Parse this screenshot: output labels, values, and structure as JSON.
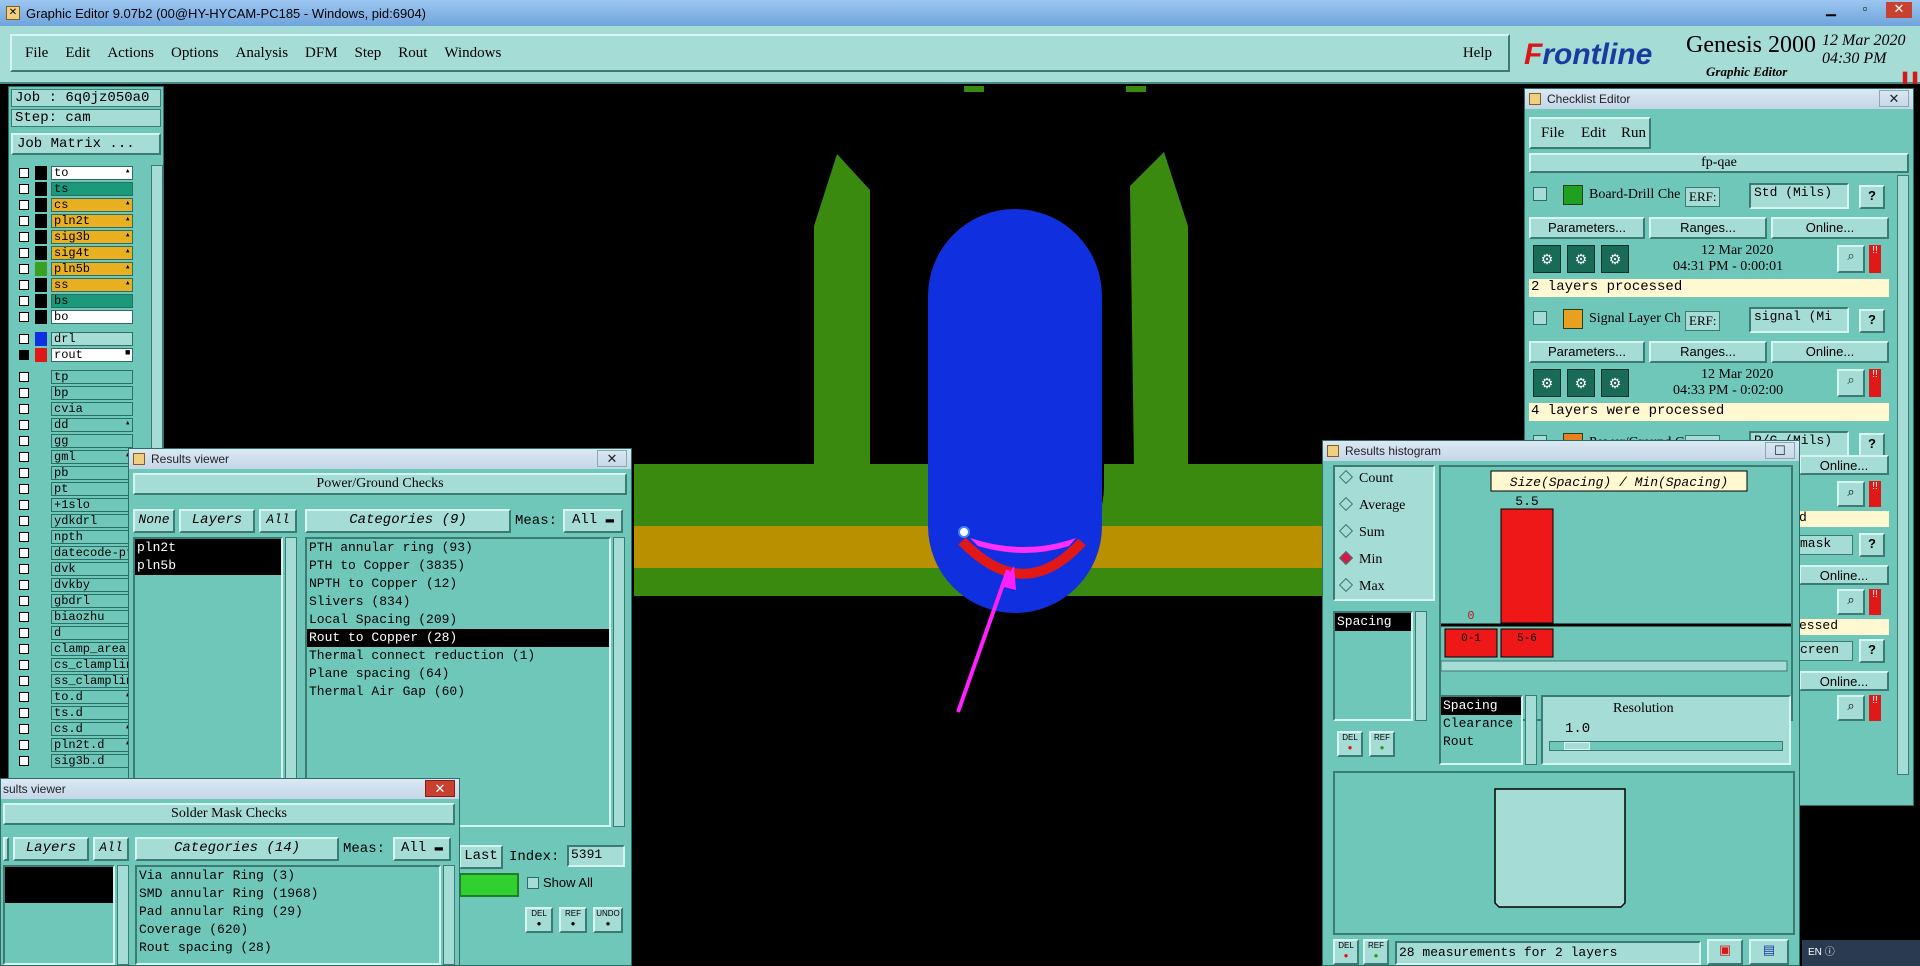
{
  "window": {
    "title": "Graphic Editor 9.07b2 (00@HY-HYCAM-PC185 - Windows, pid:6904)"
  },
  "menu": [
    "File",
    "Edit",
    "Actions",
    "Options",
    "Analysis",
    "DFM",
    "Step",
    "Rout",
    "Windows"
  ],
  "help": "Help",
  "brand": {
    "logo_red": "F",
    "logo_rest": "rontline",
    "product": "Genesis 2000",
    "subtitle": "Graphic Editor",
    "date": "12 Mar 2020",
    "time": "04:30 PM"
  },
  "job": {
    "job": "Job : 6q0jz050a0",
    "step": "Step: cam",
    "matrix_btn": "Job Matrix ..."
  },
  "layers_board": [
    {
      "name": "to",
      "color": "#ffffff",
      "sw": "#000000",
      "flag": "▴"
    },
    {
      "name": "ts",
      "color": "#1a9a7a",
      "sw": "#000000",
      "flag": ""
    },
    {
      "name": "cs",
      "color": "#e8b020",
      "sw": "#000000",
      "flag": "▴"
    },
    {
      "name": "pln2t",
      "color": "#e8b020",
      "sw": "#000000",
      "flag": "▴"
    },
    {
      "name": "sig3b",
      "color": "#e8b020",
      "sw": "#000000",
      "flag": "▴"
    },
    {
      "name": "sig4t",
      "color": "#e8b020",
      "sw": "#000000",
      "flag": "▴"
    },
    {
      "name": "pln5b",
      "color": "#e8b020",
      "sw": "#3aa020",
      "flag": "▴"
    },
    {
      "name": "ss",
      "color": "#e8b020",
      "sw": "#000000",
      "flag": "▴"
    },
    {
      "name": "bs",
      "color": "#1a9a7a",
      "sw": "#000000",
      "flag": ""
    },
    {
      "name": "bo",
      "color": "#ffffff",
      "sw": "#000000",
      "flag": ""
    }
  ],
  "layers_drill": [
    {
      "name": "drl",
      "color": "#a6dcd6",
      "sw": "#1030e0",
      "flag": ""
    },
    {
      "name": "rout",
      "color": "#ffffff",
      "sw": "#e01818",
      "flag": "■"
    }
  ],
  "layers_misc": [
    {
      "name": "tp",
      "flag": ""
    },
    {
      "name": "bp",
      "flag": ""
    },
    {
      "name": "cvia",
      "flag": ""
    },
    {
      "name": "dd",
      "flag": "▴"
    },
    {
      "name": "gg",
      "flag": ""
    },
    {
      "name": "gml",
      "flag": "▴"
    },
    {
      "name": "pb",
      "flag": ""
    },
    {
      "name": "pt",
      "flag": ""
    },
    {
      "name": "+1slo",
      "flag": ""
    },
    {
      "name": "ydkdrl",
      "flag": ""
    },
    {
      "name": "npth",
      "flag": ""
    },
    {
      "name": "datecode-pt",
      "flag": ""
    },
    {
      "name": "dvk",
      "flag": ""
    },
    {
      "name": "dvkby",
      "flag": ""
    },
    {
      "name": "gbdrl",
      "flag": ""
    },
    {
      "name": "biaozhu",
      "flag": ""
    },
    {
      "name": "d",
      "flag": ""
    },
    {
      "name": "clamp_area",
      "flag": ""
    },
    {
      "name": "cs_clamplin",
      "flag": ""
    },
    {
      "name": "ss_clamplin",
      "flag": ""
    },
    {
      "name": "to.d",
      "flag": "▴"
    },
    {
      "name": "ts.d",
      "flag": ""
    },
    {
      "name": "cs.d",
      "flag": "▴"
    },
    {
      "name": "pln2t.d",
      "flag": "▴"
    },
    {
      "name": "sig3b.d",
      "flag": ""
    }
  ],
  "results1": {
    "title": "Results viewer",
    "header": "Power/Ground Checks",
    "none": "None",
    "layers": "Layers",
    "all": "All",
    "categories": "Categories (9)",
    "meas_label": "Meas:",
    "meas_value": "All",
    "layer_items": [
      "pln2t",
      "pln5b"
    ],
    "cat_items": [
      "PTH annular ring (93)",
      "PTH to Copper (3835)",
      "NPTH to Copper (12)",
      "Slivers (834)",
      "Local Spacing (209)",
      "Rout to Copper (28)",
      "Thermal connect reduction (1)",
      "Plane spacing (64)",
      "Thermal Air Gap (60)"
    ],
    "selected_cat": 5,
    "last": "Last",
    "index_label": "Index:",
    "index_value": "5391",
    "show_all": "Show All",
    "del": "DEL",
    "ref": "REF",
    "undo": "UNDO"
  },
  "results2": {
    "title": "sults viewer",
    "header": "Solder Mask Checks",
    "layers": "Layers",
    "all": "All",
    "categories": "Categories (14)",
    "meas_label": "Meas:",
    "meas_value": "All",
    "cat_items": [
      "Via annular Ring (3)",
      "SMD annular Ring (1968)",
      "Pad annular Ring (29)",
      "Coverage (620)",
      "Rout spacing (28)"
    ]
  },
  "checklist": {
    "title": "Checklist Editor",
    "menu": [
      "File",
      "Edit",
      "Run"
    ],
    "name": "fp-qae",
    "erf": "ERF:",
    "params": "Parameters...",
    "ranges": "Ranges...",
    "online": "Online...",
    "checks": [
      {
        "name": "Board-Drill Che",
        "erf_val": "Std (Mils)",
        "date": "12 Mar 2020",
        "time": "04:31 PM - 0:00:01",
        "status": "2 layers processed"
      },
      {
        "name": "Signal Layer Ch",
        "erf_val": "signal (Mi",
        "date": "12 Mar 2020",
        "time": "04:33 PM - 0:02:00",
        "status": "4 layers were processed"
      },
      {
        "name": "Power/Ground C",
        "erf_val": "P/G (Mils)",
        "date": "",
        "time": "",
        "status": ""
      }
    ],
    "partial": [
      "d",
      "mask",
      "essed",
      "creen"
    ]
  },
  "histogram": {
    "title": "Results histogram",
    "radios": [
      "Count",
      "Average",
      "Sum",
      "Min",
      "Max"
    ],
    "selected_radio": 3,
    "left_item": "Spacing",
    "chart_title": "Size(Spacing) / Min(Spacing)",
    "bar_value_label": "5.5",
    "zero_label": "0",
    "bins": [
      "0-1",
      "5-6"
    ],
    "types": [
      "Spacing",
      "Clearance",
      "Rout"
    ],
    "resolution_label": "Resolution",
    "resolution_value": "1.0",
    "del": "DEL",
    "ref": "REF",
    "status": "28 measurements for 2 layers"
  },
  "chart_data": {
    "type": "bar",
    "title": "Size(Spacing) / Min(Spacing)",
    "categories": [
      "0-1",
      "5-6"
    ],
    "values": [
      0,
      5.5
    ],
    "ylim": [
      0,
      5.5
    ]
  },
  "tray": {
    "lang": "EN"
  }
}
